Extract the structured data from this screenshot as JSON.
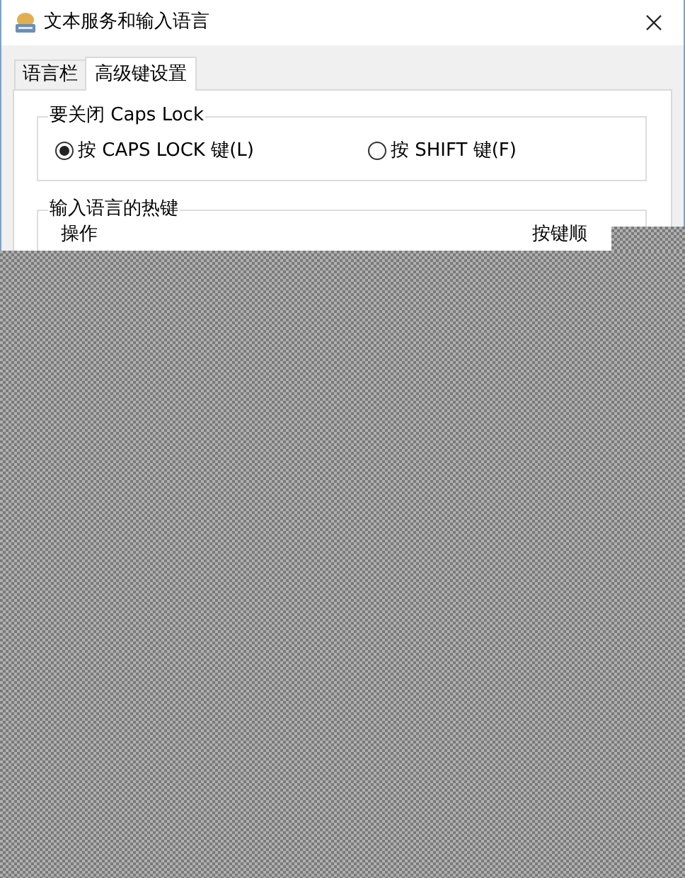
{
  "window": {
    "title": "文本服务和输入语言"
  },
  "tabs": [
    {
      "label": "语言栏",
      "selected": false
    },
    {
      "label": "高级键设置",
      "selected": true
    }
  ],
  "caps_lock_group": {
    "title": "要关闭 Caps Lock",
    "options": [
      {
        "label": "按 CAPS LOCK 键(L)",
        "selected": true
      },
      {
        "label": "按 SHIFT 键(F)",
        "selected": false
      }
    ]
  },
  "hotkeys_group": {
    "title": "输入语言的热键",
    "columns": [
      "操作",
      "按键顺"
    ]
  }
}
